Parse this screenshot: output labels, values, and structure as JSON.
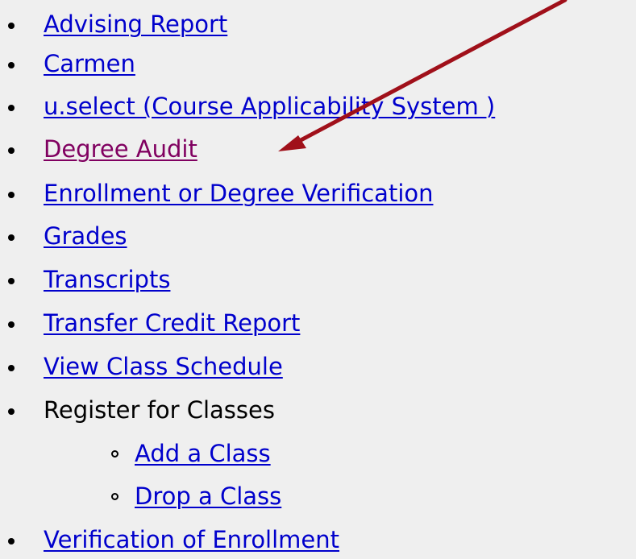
{
  "links": [
    {
      "label": "Advising Report",
      "type": "link"
    },
    {
      "label": "Carmen",
      "type": "link"
    },
    {
      "label": "u.select (Course Applicability System )",
      "type": "link"
    },
    {
      "label": "Degree Audit",
      "type": "visited-link"
    },
    {
      "label": "Enrollment or Degree Verification",
      "type": "link"
    },
    {
      "label": "Grades",
      "type": "link"
    },
    {
      "label": "Transcripts",
      "type": "link"
    },
    {
      "label": "Transfer Credit Report",
      "type": "link"
    },
    {
      "label": "View Class Schedule",
      "type": "link"
    },
    {
      "label": "Register for Classes",
      "type": "text"
    },
    {
      "label": "Add a Class",
      "type": "sub-link"
    },
    {
      "label": "Drop a Class",
      "type": "sub-link"
    },
    {
      "label": "Verification of Enrollment",
      "type": "link"
    }
  ],
  "annotation": {
    "color": "#a0101a",
    "icon": "red-arrow-icon",
    "points_to": "Degree Audit"
  },
  "colors": {
    "link": "#0000cc",
    "visited_link": "#800060",
    "background": "#efefef"
  }
}
